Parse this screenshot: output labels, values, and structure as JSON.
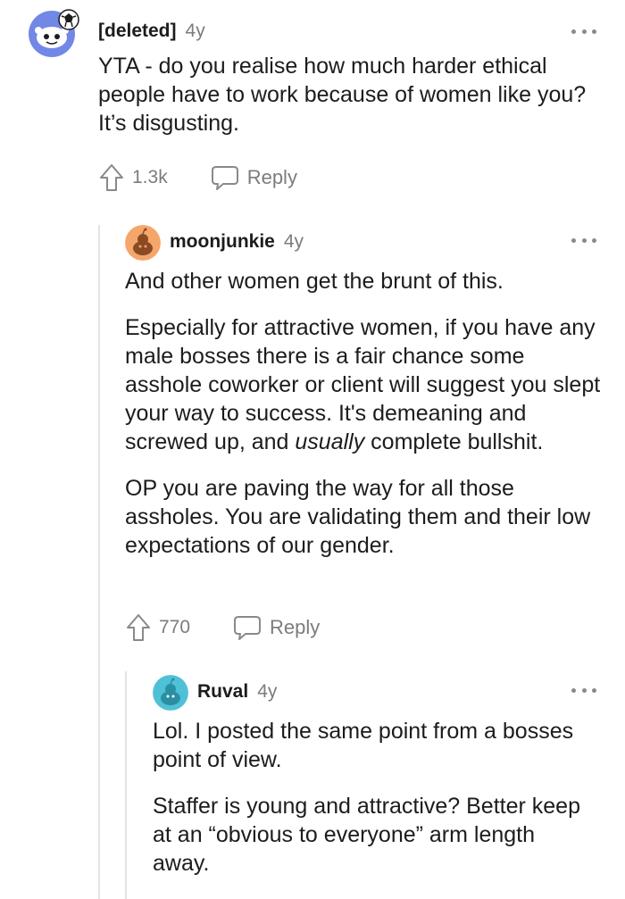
{
  "comments": [
    {
      "author": "[deleted]",
      "age": "4y",
      "paragraphs": [
        "YTA - do you realise how much harder ethical people have to work because of women like you? It’s disgusting."
      ],
      "upvotes": "1.3k",
      "reply_label": "Reply",
      "avatar_color": "#6b7fe0"
    },
    {
      "author": "moonjunkie",
      "age": "4y",
      "paragraphs": [
        "And other women get the brunt of this.",
        "Especially for attractive women, if you have any male bosses there is a fair chance some asshole coworker or client will suggest you slept your way to success. It's demeaning and screwed up, and ",
        "OP you are paving the way for all those assholes. You are validating them and their low expectations of our gender."
      ],
      "p2_italic": "usually",
      "p2_tail": " complete bullshit.",
      "upvotes": "770",
      "reply_label": "Reply",
      "avatar_color": "#f5a66a"
    },
    {
      "author": "Ruval",
      "age": "4y",
      "paragraphs": [
        "Lol. I posted the same point from a bosses point of view.",
        "Staffer is young and attractive? Better keep at an “obvious to everyone” arm length away."
      ],
      "avatar_color": "#4fc1d7"
    }
  ],
  "icons": {
    "upvote": "upvote-arrow-icon",
    "reply": "speech-bubble-icon",
    "more": "more-dots-icon"
  }
}
